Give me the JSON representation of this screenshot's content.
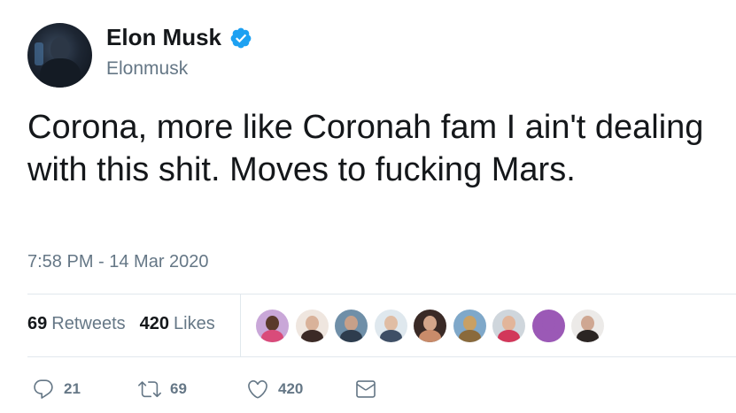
{
  "author": {
    "name": "Elon Musk",
    "handle": "Elonmusk",
    "verified": true
  },
  "tweet": {
    "text": "Corona, more like Coronah fam I ain't dealing with this shit. Moves to fucking Mars.",
    "timestamp": "7:58 PM - 14 Mar 2020"
  },
  "stats": {
    "retweets_count": "69",
    "retweets_label": "Retweets",
    "likes_count": "420",
    "likes_label": "Likes"
  },
  "likers": [
    {
      "bg": "#c9a7d8",
      "face": "#5a3a2c",
      "shirt": "#d94b7a"
    },
    {
      "bg": "#efe6df",
      "face": "#d9b29a",
      "shirt": "#3b2a26"
    },
    {
      "bg": "#6f8fa8",
      "face": "#c7a089",
      "shirt": "#2e3d4e"
    },
    {
      "bg": "#dfe8ee",
      "face": "#e0bda4",
      "shirt": "#3f4f66"
    },
    {
      "bg": "#3a2a26",
      "face": "#d3a58a",
      "shirt": "#c98b6a"
    },
    {
      "bg": "#7fa8c9",
      "face": "#c9a064",
      "shirt": "#8a6a3c"
    },
    {
      "bg": "#cfd6dc",
      "face": "#e2b59a",
      "shirt": "#d2375a"
    },
    {
      "bg": "#9b59b6",
      "face": "#9b59b6",
      "shirt": "#9b59b6"
    },
    {
      "bg": "#eceae8",
      "face": "#cfa792",
      "shirt": "#2b2523"
    }
  ],
  "actions": {
    "reply_count": "21",
    "retweet_count": "69",
    "like_count": "420"
  },
  "colors": {
    "verified_badge": "#1da1f2",
    "secondary_text": "#657786",
    "divider": "#e1e8ed"
  },
  "icons": {
    "verified": "verified-badge-icon",
    "reply": "reply-icon",
    "retweet": "retweet-icon",
    "like": "heart-icon",
    "dm": "envelope-icon"
  }
}
